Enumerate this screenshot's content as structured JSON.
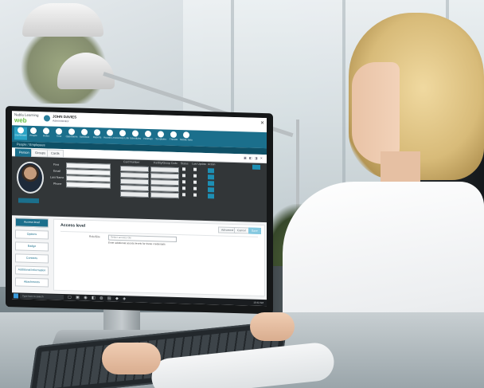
{
  "app": {
    "logo_text": "Nabla Learning",
    "logo_mark": "web",
    "user_name": "JOHN DAVIES",
    "user_role": "Administrator",
    "close_label": "✕"
  },
  "icon_bar": [
    {
      "label": "Dashboard",
      "icon": "dashboard-icon",
      "active": true
    },
    {
      "label": "People",
      "icon": "people-icon"
    },
    {
      "label": "Roles",
      "icon": "roles-icon"
    },
    {
      "label": "Time",
      "icon": "time-icon"
    },
    {
      "label": "Operations",
      "icon": "operations-icon"
    },
    {
      "label": "Schedule",
      "icon": "schedule-icon"
    },
    {
      "label": "Reports",
      "icon": "reports-icon"
    },
    {
      "label": "Access Levels",
      "icon": "access-icon"
    },
    {
      "label": "Access Links",
      "icon": "links-icon"
    },
    {
      "label": "Schedules",
      "icon": "calendar-icon"
    },
    {
      "label": "Holidays",
      "icon": "holiday-icon"
    },
    {
      "label": "Templates",
      "icon": "template-icon"
    },
    {
      "label": "Threats",
      "icon": "threat-icon"
    },
    {
      "label": "Mobile Setup",
      "icon": "mobile-icon"
    }
  ],
  "sub_bar_label": "People / Employees",
  "tabs": [
    {
      "label": "Person",
      "active": true
    },
    {
      "label": "Groups"
    },
    {
      "label": "Cards"
    }
  ],
  "tab_tools": "▣ ◧ ◨ ✕",
  "profile": {
    "fields": [
      {
        "label": "First",
        "value": ""
      },
      {
        "label": "Email",
        "value": ""
      },
      {
        "label": "Last Name",
        "value": ""
      },
      {
        "label": "Phone",
        "value": ""
      }
    ],
    "grid_headers": [
      "Card Number",
      "Facility/Group Code",
      "Status",
      "Last Update",
      "Action"
    ],
    "photo_button": "Change Photo"
  },
  "left_nav": [
    {
      "label": "Access level",
      "active": true
    },
    {
      "label": "Options"
    },
    {
      "label": "Badge"
    },
    {
      "label": "Contacts"
    },
    {
      "label": "Additional Information"
    },
    {
      "label": "Attachments"
    }
  ],
  "content": {
    "title": "Access level",
    "buttons": [
      "Advanced",
      "Cancel",
      "Save"
    ],
    "role_label": "Role/Site",
    "role_placeholder": "Select access role",
    "info_text": "Enter additional access levels for these credentials"
  },
  "taskbar": {
    "search_placeholder": "Type here to search",
    "icons": "▢ ▣ ◉ ◧ ◍ ▤ ◆ ◈",
    "clock": "10:42 AM"
  },
  "colors": {
    "brand_teal": "#1b6f8c",
    "accent_blue": "#1d8fb4",
    "logo_green": "#6cc04a",
    "profile_panel": "#323638"
  }
}
